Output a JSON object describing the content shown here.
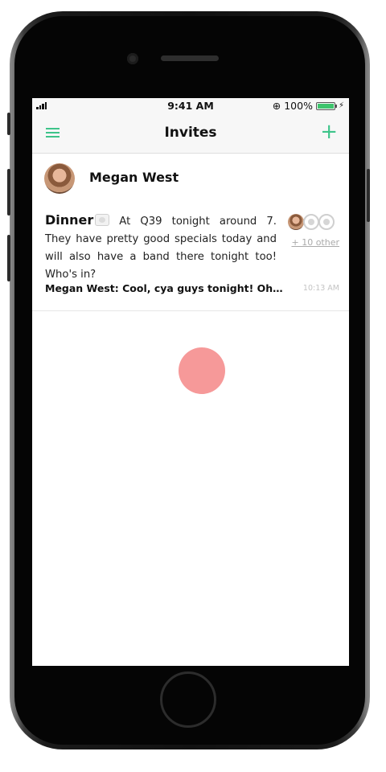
{
  "status": {
    "time": "9:41 AM",
    "battery": "100%"
  },
  "nav": {
    "title": "Invites",
    "menu_icon": "hamburger-menu-icon",
    "add_icon": "plus-icon"
  },
  "invite": {
    "author": "Megan West",
    "title": "Dinner",
    "body": "At Q39 tonight around 7. They have pretty good specials today and will also have a band there tonight too! Who's in?",
    "others": "+ 10 other",
    "last_message": "Megan West: Cool, cya guys tonight! Oh Kayla needs a ride too",
    "last_message_time": "10:13 AM"
  },
  "colors": {
    "accent": "#3ec48a",
    "tap": "#f05050"
  }
}
